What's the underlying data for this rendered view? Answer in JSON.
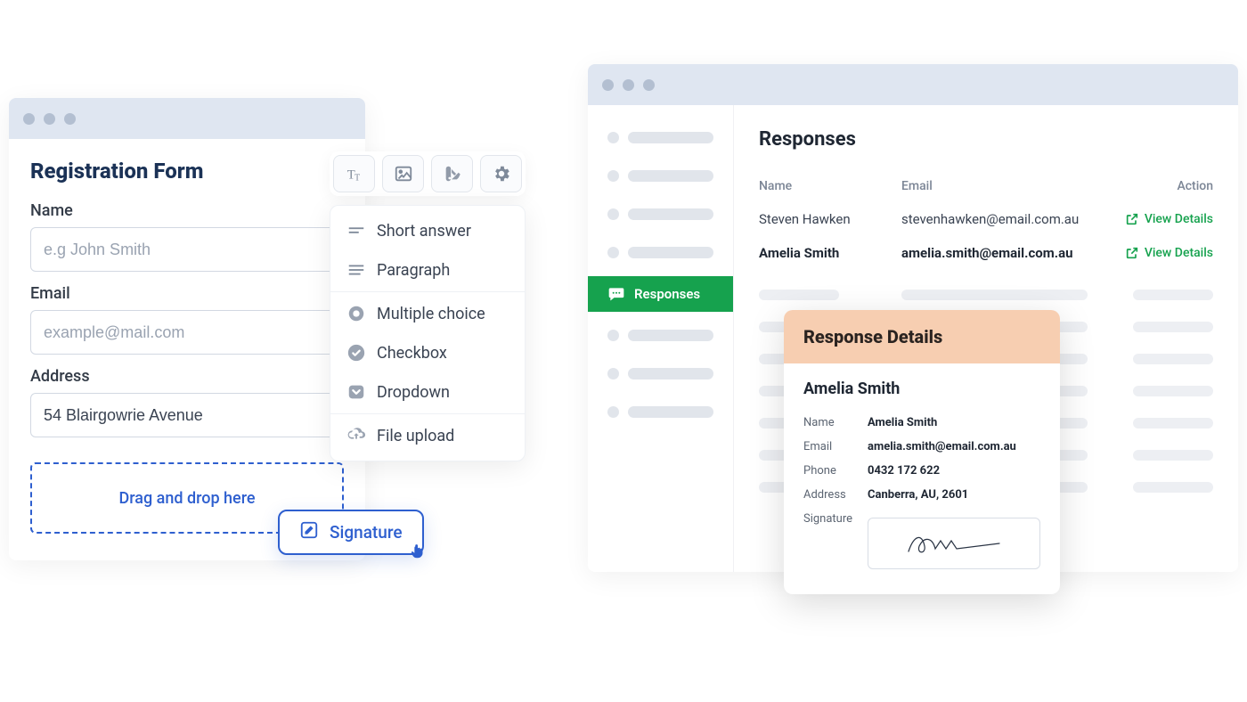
{
  "registration": {
    "title": "Registration Form",
    "name_label": "Name",
    "name_placeholder": "e.g John Smith",
    "email_label": "Email",
    "email_placeholder": "example@mail.com",
    "address_label": "Address",
    "address_value": "54 Blairgowrie Avenue",
    "dropzone": "Drag and drop here"
  },
  "toolbar_icons": [
    "text-icon",
    "image-icon",
    "swatch-icon",
    "gear-icon"
  ],
  "field_types": {
    "short_answer": "Short answer",
    "paragraph": "Paragraph",
    "multiple_choice": "Multiple choice",
    "checkbox": "Checkbox",
    "dropdown": "Dropdown",
    "file_upload": "File upload"
  },
  "signature_chip": "Signature",
  "responses": {
    "sidebar_active": "Responses",
    "title": "Responses",
    "cols": {
      "name": "Name",
      "email": "Email",
      "action": "Action"
    },
    "rows": [
      {
        "name": "Steven Hawken",
        "email": "stevenhawken@email.com.au",
        "action": "View Details"
      },
      {
        "name": "Amelia Smith",
        "email": "amelia.smith@email.com.au",
        "action": "View Details"
      }
    ]
  },
  "details": {
    "heading": "Response Details",
    "person": "Amelia Smith",
    "name_label": "Name",
    "name_value": "Amelia Smith",
    "email_label": "Email",
    "email_value": "amelia.smith@email.com.au",
    "phone_label": "Phone",
    "phone_value": "0432 172 622",
    "address_label": "Address",
    "address_value": "Canberra, AU, 2601",
    "signature_label": "Signature"
  }
}
